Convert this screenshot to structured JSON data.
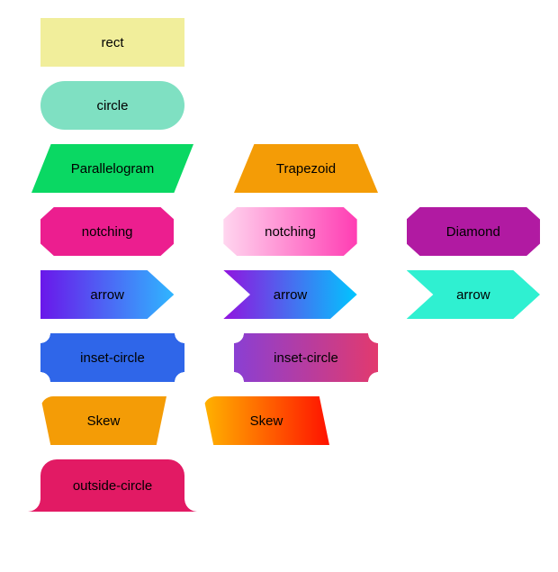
{
  "shapes": {
    "rect": "rect",
    "circle": "circle",
    "parallelogram": "Parallelogram",
    "trapezoid": "Trapezoid",
    "notching1": "notching",
    "notching2": "notching",
    "diamond": "Diamond",
    "arrow1": "arrow",
    "arrow2": "arrow",
    "arrow3": "arrow",
    "inset1": "inset-circle",
    "inset2": "inset-circle",
    "skew1": "Skew",
    "skew2": "Skew",
    "outside": "outside-circle"
  }
}
